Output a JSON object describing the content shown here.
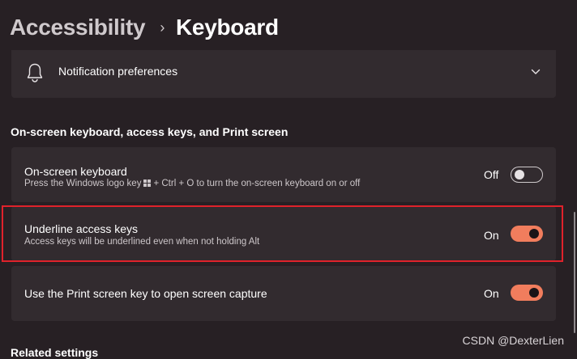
{
  "breadcrumb": {
    "parent": "Accessibility",
    "separator": "›",
    "current": "Keyboard"
  },
  "notification": {
    "label": "Notification preferences",
    "icon": "bell-icon",
    "expand_icon": "chevron-down-icon"
  },
  "section": {
    "heading": "On-screen keyboard, access keys, and Print screen"
  },
  "settings": [
    {
      "title": "On-screen keyboard",
      "subtitle_before": "Press the Windows logo key",
      "subtitle_icon": "windows-logo-icon",
      "subtitle_after": "+ Ctrl + O to turn the on-screen keyboard on or off",
      "state": "Off",
      "on": false
    },
    {
      "title": "Underline access keys",
      "subtitle": "Access keys will be underlined even when not holding Alt",
      "state": "On",
      "on": true
    },
    {
      "title": "Use the Print screen key to open screen capture",
      "state": "On",
      "on": true
    }
  ],
  "related": {
    "heading": "Related settings"
  },
  "watermark": "CSDN @DexterLien",
  "colors": {
    "background": "#272024",
    "card": "#322b2f",
    "accent": "#f17d5d",
    "highlight": "#e0222b"
  }
}
